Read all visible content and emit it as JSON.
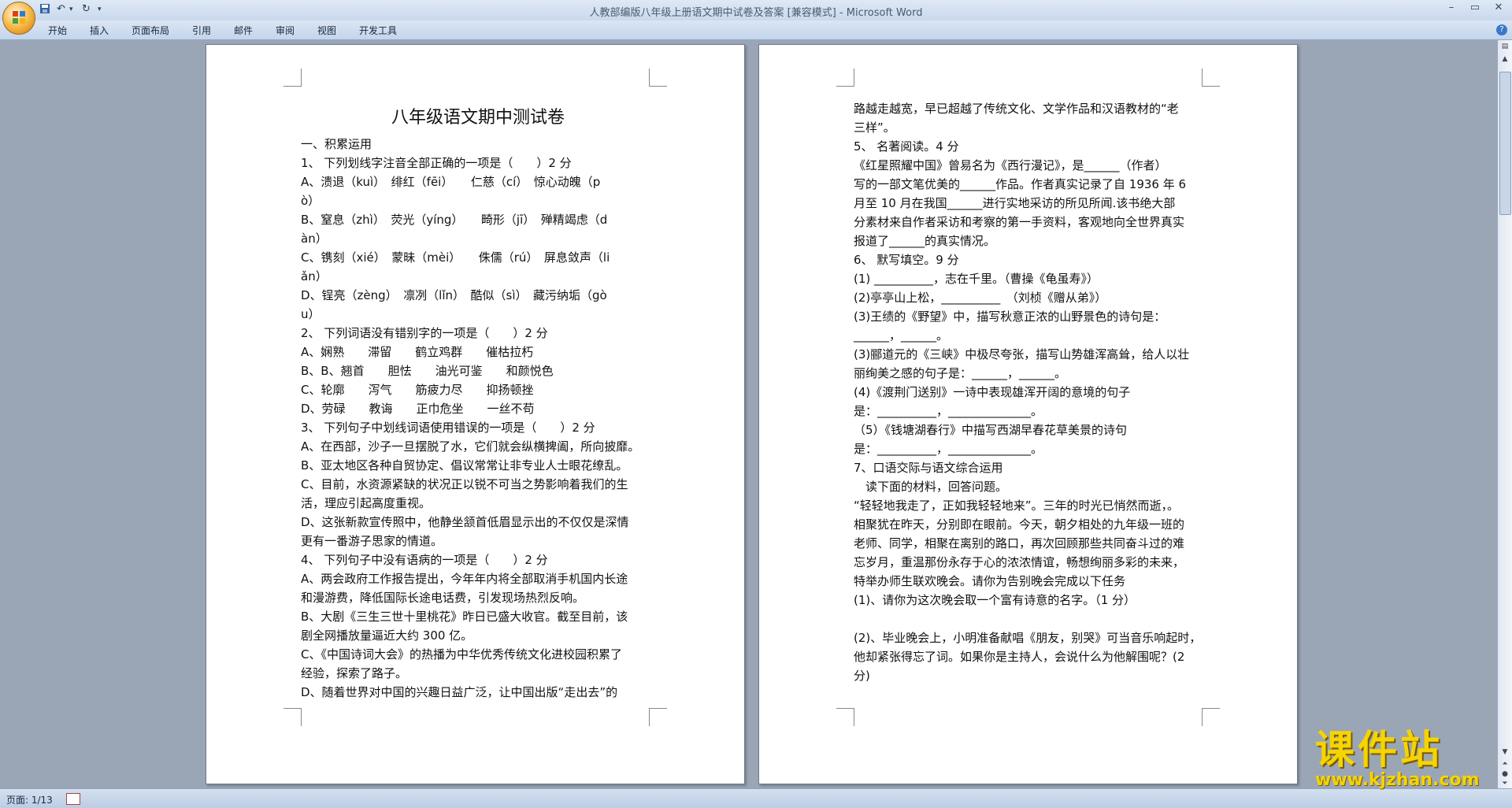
{
  "window": {
    "title": "人教部编版八年级上册语文期中试卷及答案 [兼容模式] - Microsoft Word"
  },
  "quick_access": {
    "save_icon": "save-icon",
    "undo_icon": "undo-icon",
    "redo_icon": "redo-icon"
  },
  "ribbon": {
    "tabs": [
      {
        "label": "开始"
      },
      {
        "label": "插入"
      },
      {
        "label": "页面布局"
      },
      {
        "label": "引用"
      },
      {
        "label": "邮件"
      },
      {
        "label": "审阅"
      },
      {
        "label": "视图"
      },
      {
        "label": "开发工具"
      }
    ]
  },
  "left_page": {
    "title": "八年级语文期中测试卷",
    "lines": [
      "一、积累运用",
      "1、 下列划线字注音全部正确的一项是（　　）2 分",
      "A、溃退（kuì）　绯红（fēi）　　仁慈（cí）　惊心动魄（p",
      "ò）",
      "B、窒息（zhì）　荧光（yíng）　　畸形（jī）　殚精竭虑（d",
      "àn）",
      "C、镌刻（xié）　蒙昧（mèi）　　侏儒（rú）　屏息敛声（li",
      "ǎn）",
      "D、锃亮（zèng）　凛冽（lǐn）　酷似（sì）　藏污纳垢（gò",
      "u）",
      "2、 下列词语没有错别字的一项是（　　）2 分",
      "A、娴熟　　滞留　　鹤立鸡群　　催枯拉朽",
      "B、B、翘首　　胆怯　　油光可鉴　　和颜悦色",
      "C、轮廓　　泻气　　筋疲力尽　　抑扬顿挫",
      "D、劳碌　　教诲　　正巾危坐　　一丝不苟",
      "3、 下列句子中划线词语使用错误的一项是（　　）2 分",
      "A、在西部，沙子一旦摆脱了水，它们就会纵横捭阖，所向披靡。",
      "B、亚太地区各种自贸协定、倡议常常让非专业人士眼花缭乱。",
      "C、目前，水资源紧缺的状况正以锐不可当之势影响着我们的生",
      "活，理应引起高度重视。",
      "D、这张新款宣传照中，他静坐颔首低眉显示出的不仅仅是深情",
      "更有一番游子思家的情道。",
      "4、 下列句子中没有语病的一项是（　　）2 分",
      "A、两会政府工作报告提出，今年年内将全部取消手机国内长途",
      "和漫游费，降低国际长途电话费，引发现场热烈反响。",
      "B、大剧《三生三世十里桃花》昨日已盛大收官。截至目前，该",
      "剧全网播放量逼近大约 300 亿。",
      "C、《中国诗词大会》的热播为中华优秀传统文化进校园积累了",
      "经验，探索了路子。",
      "D、随着世界对中国的兴趣日益广泛，让中国出版“走出去”的"
    ]
  },
  "right_page": {
    "lines": [
      "路越走越宽，早已超越了传统文化、文学作品和汉语教材的“老",
      "三样”。",
      "5、 名著阅读。4 分",
      "《红星照耀中国》曾易名为《西行漫记》，是______（作者）",
      "写的一部文笔优美的______作品。作者真实记录了自 1936 年 6",
      "月至 10 月在我国______进行实地采访的所见所闻.该书绝大部",
      "分素材来自作者采访和考察的第一手资料，客观地向全世界真实",
      "报道了______的真实情况。",
      "6、 默写填空。9 分",
      "(1) __________，志在千里。（曹操《龟虽寿》）",
      "(2)亭亭山上松，__________　（刘桢《赠从弟》）",
      "(3)王绩的《野望》中，描写秋意正浓的山野景色的诗句是：",
      "______，______。",
      "(3)郦道元的《三峡》中极尽夸张，描写山势雄浑高耸，给人以壮",
      "丽绚美之感的句子是：______，______。",
      "(4)《渡荆门送别》一诗中表现雄浑开阔的意境的句子",
      "是：__________，______________。",
      "（5）《钱塘湖春行》中描写西湖早春花草美景的诗句",
      "是：__________，______________。",
      "7、口语交际与语文综合运用",
      "　读下面的材料，回答问题。",
      "“轻轻地我走了，正如我轻轻地来”。三年的时光已悄然而逝，。",
      "相聚犹在昨天，分别即在眼前。今天，朝夕相处的九年级一班的",
      "老师、同学，相聚在离别的路口，再次回顾那些共同奋斗过的难",
      "忘岁月，重温那份永存于心的浓浓情谊，畅想绚丽多彩的未来，",
      "特举办师生联欢晚会。请你为告别晚会完成以下任务",
      "(1)、请你为这次晚会取一个富有诗意的名字。（1 分）",
      "",
      "(2)、毕业晚会上，小明准备献唱《朋友，别哭》可当音乐响起时，",
      "他却紧张得忘了词。如果你是主持人，会说什么为他解围呢？(2",
      "分)"
    ]
  },
  "statusbar": {
    "page_info": "页面: 1/13"
  },
  "watermark": {
    "text": "课件站",
    "url": "www.kjzhan.com"
  },
  "colors": {
    "workspace": "#9aa6b6",
    "ribbon": "#c4d4ea",
    "watermark": "#f5d400"
  }
}
